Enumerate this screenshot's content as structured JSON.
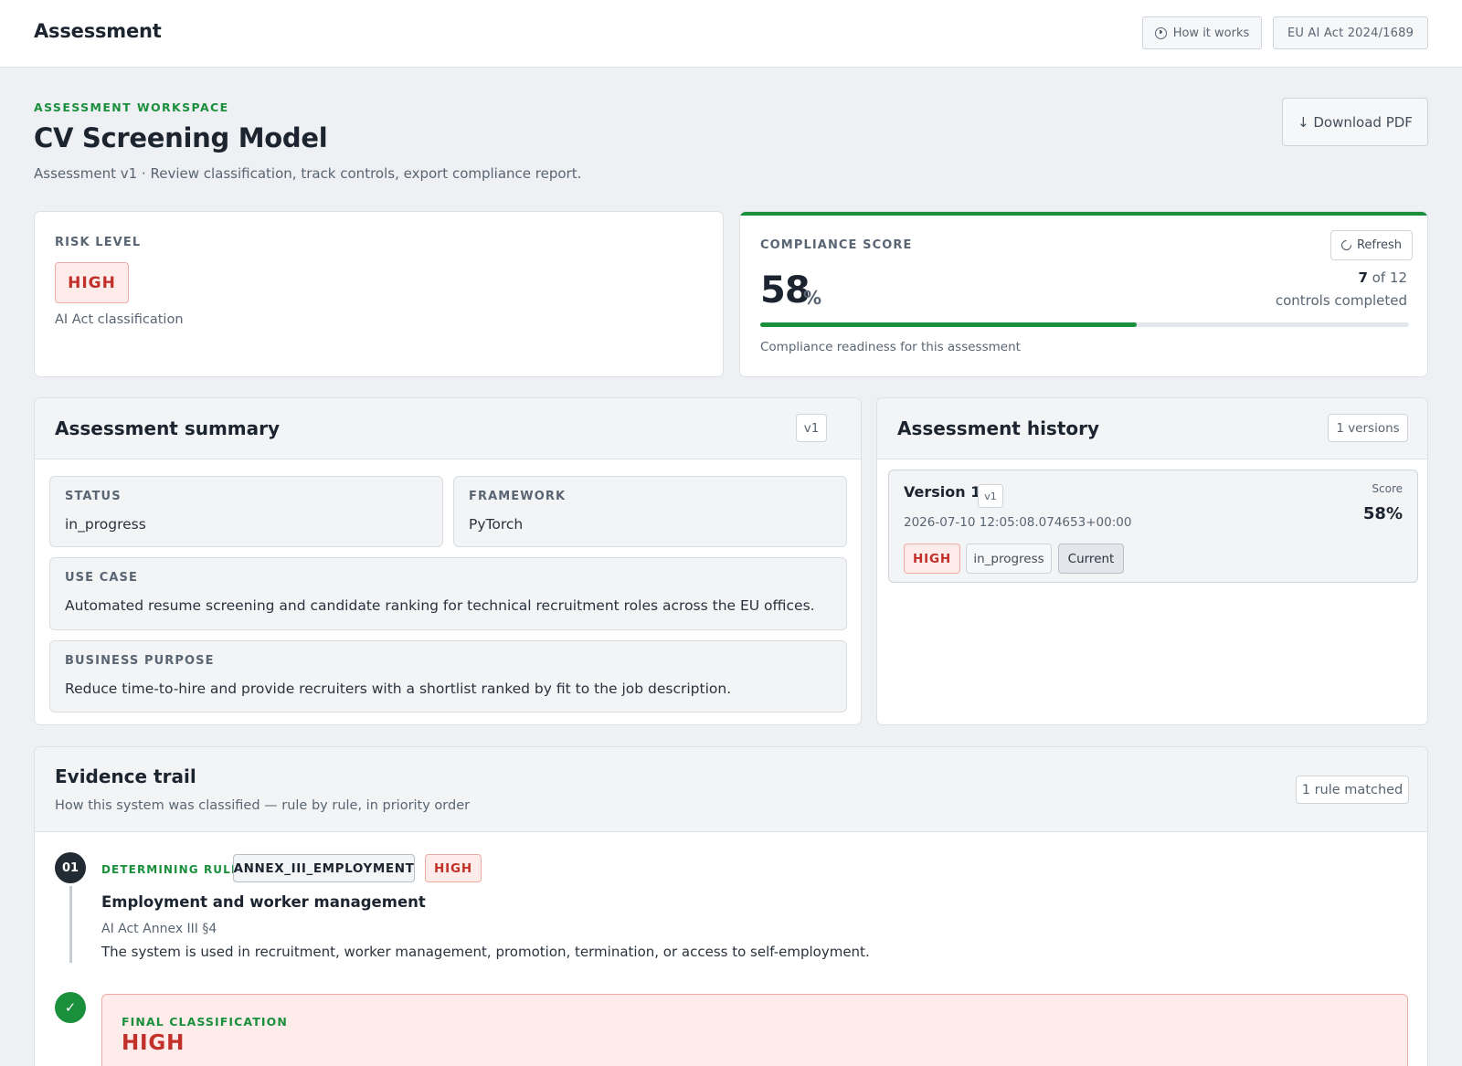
{
  "app": {
    "title": "Assessment",
    "how_it_works": "How it works",
    "regulation": "EU AI Act 2024/1689"
  },
  "header": {
    "eyebrow": "ASSESSMENT WORKSPACE",
    "title": "CV Screening Model",
    "subtitle": "Assessment v1 · Review classification, track controls, export compliance report.",
    "download_label": "↓ Download PDF"
  },
  "risk": {
    "label": "RISK LEVEL",
    "value": "HIGH",
    "caption": "AI Act classification"
  },
  "compliance": {
    "label": "COMPLIANCE SCORE",
    "refresh_label": "Refresh",
    "score": "58",
    "score_unit": "%",
    "score_fraction": 0.58,
    "completed": "7",
    "total_text": "of 12",
    "controls_caption": "controls completed",
    "caption": "Compliance readiness for this assessment"
  },
  "summary": {
    "title": "Assessment summary",
    "version_chip": "v1",
    "fields": {
      "status": {
        "label": "STATUS",
        "value": "in_progress"
      },
      "framework": {
        "label": "FRAMEWORK",
        "value": "PyTorch"
      },
      "use_case": {
        "label": "USE CASE",
        "value": "Automated resume screening and candidate ranking for technical recruitment roles across the EU offices."
      },
      "business_purpose": {
        "label": "BUSINESS PURPOSE",
        "value": "Reduce time-to-hire and provide recruiters with a shortlist ranked by fit to the job description."
      }
    }
  },
  "history": {
    "title": "Assessment history",
    "count_chip": "1 versions",
    "versions": [
      {
        "title": "Version 1",
        "chip": "v1",
        "date": "2026-07-10 12:05:08.074653+00:00",
        "risk": "HIGH",
        "status": "in_progress",
        "current": "Current",
        "score_label": "Score",
        "score": "58%"
      }
    ]
  },
  "evidence": {
    "title": "Evidence trail",
    "subtitle": "How this system was classified — rule by rule, in priority order",
    "matched_chip": "1 rule matched",
    "rules": [
      {
        "num": "01",
        "label": "DETERMINING RULE",
        "code": "ANNEX_III_EMPLOYMENT",
        "risk": "HIGH",
        "title": "Employment and worker management",
        "reference": "AI Act Annex III §4",
        "description": "The system is used in recruitment, worker management, promotion, termination, or access to self-employment."
      }
    ],
    "final_label": "FINAL CLASSIFICATION",
    "final_value": "HIGH",
    "check_glyph": "✓"
  },
  "colors": {
    "accent_green": "#1a8f3c",
    "risk_red": "#c2302a",
    "risk_bg": "#fdecea",
    "background": "#eef0f3"
  }
}
